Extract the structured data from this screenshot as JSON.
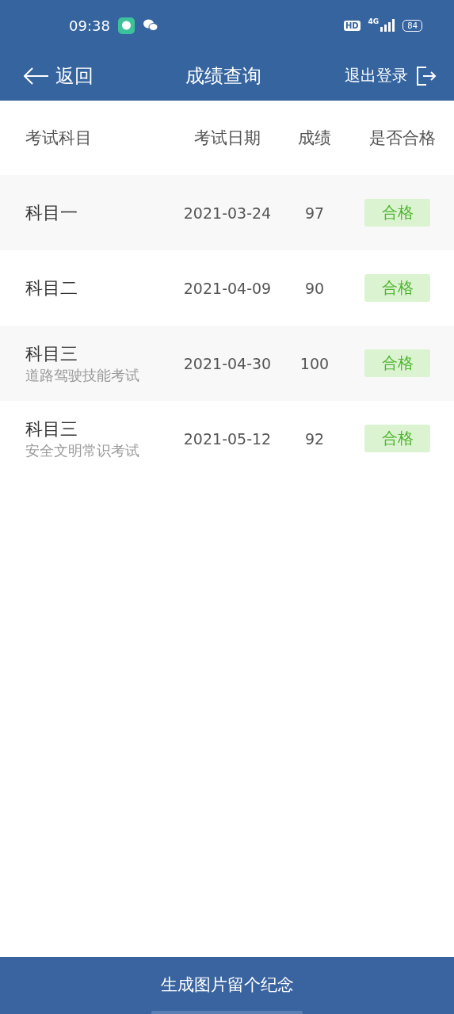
{
  "status_bar": {
    "time": "09:38",
    "hd": "HD",
    "network": "4G",
    "battery": "84"
  },
  "header": {
    "back": "返回",
    "title": "成绩查询",
    "logout": "退出登录"
  },
  "table": {
    "columns": [
      "考试科目",
      "考试日期",
      "成绩",
      "是否合格"
    ],
    "rows": [
      {
        "subject": "科目一",
        "date": "2021-03-24",
        "score": "97",
        "result": "合格",
        "passed": true
      },
      {
        "subject": "科目二",
        "date": "2021-04-09",
        "score": "90",
        "result": "合格",
        "passed": true
      },
      {
        "subject": "科目三",
        "detail": "道路驾驶技能考试",
        "date": "2021-04-30",
        "score": "100",
        "result": "合格",
        "passed": true
      },
      {
        "subject": "科目三",
        "detail": "安全文明常识考试",
        "date": "2021-05-12",
        "score": "92",
        "result": "合格",
        "passed": true
      }
    ]
  },
  "footer_button": "生成图片留个纪念"
}
